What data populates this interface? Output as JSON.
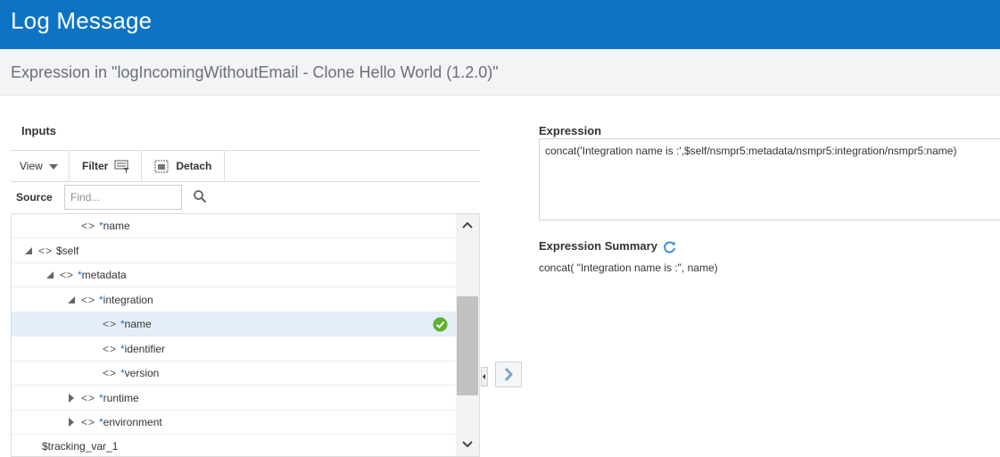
{
  "window": {
    "title": "Log Message"
  },
  "subheader": {
    "text": "Expression in \"logIncomingWithoutEmail - Clone Hello World (1.2.0)\""
  },
  "inputs": {
    "heading": "Inputs",
    "toolbar": {
      "view_label": "View",
      "filter_label": "Filter",
      "detach_label": "Detach"
    },
    "source_label": "Source",
    "find_placeholder": "Find...",
    "tree": [
      {
        "prefix": "*",
        "name": "name",
        "toggle": "none",
        "selected": false
      },
      {
        "prefix": "",
        "name": "$self",
        "toggle": "expanded",
        "selected": false
      },
      {
        "prefix": "*",
        "name": "metadata",
        "toggle": "expanded",
        "selected": false
      },
      {
        "prefix": "*",
        "name": "integration",
        "toggle": "expanded",
        "selected": false
      },
      {
        "prefix": "*",
        "name": "name",
        "toggle": "none",
        "selected": true
      },
      {
        "prefix": "*",
        "name": "identifier",
        "toggle": "none",
        "selected": false
      },
      {
        "prefix": "*",
        "name": "version",
        "toggle": "none",
        "selected": false
      },
      {
        "prefix": "*",
        "name": "runtime",
        "toggle": "collapsed",
        "selected": false
      },
      {
        "prefix": "*",
        "name": "environment",
        "toggle": "collapsed",
        "selected": false
      },
      {
        "prefix": "",
        "name": "$tracking_var_1",
        "toggle": "none",
        "selected": false
      }
    ]
  },
  "expression": {
    "label": "Expression",
    "value": "concat('Integration name is :',$self/nsmpr5:metadata/nsmpr5:integration/nsmpr5:name)"
  },
  "summary": {
    "label": "Expression Summary",
    "value": "concat( \"Integration name is :\", name)"
  },
  "colors": {
    "header": "#0d74c4",
    "selection": "#e4eef8",
    "check": "#62b02e",
    "accent": "#1a73c8"
  }
}
